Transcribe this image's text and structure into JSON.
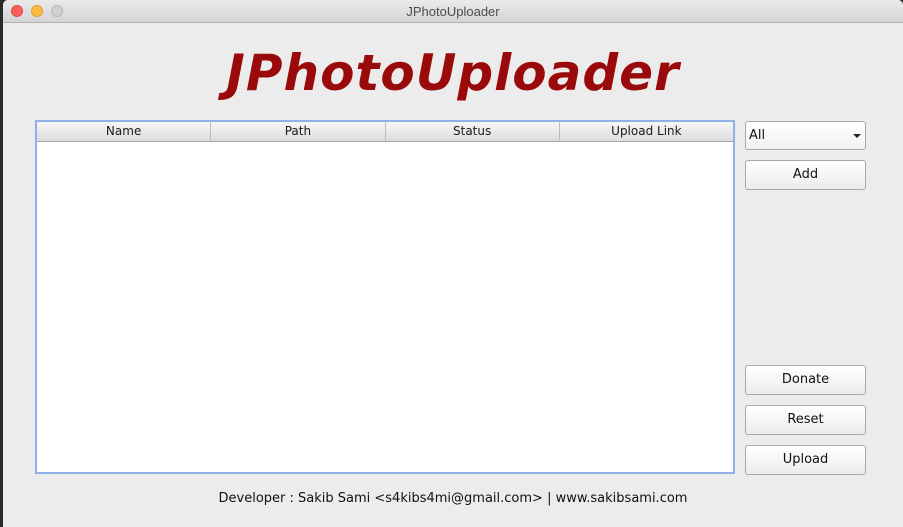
{
  "window": {
    "title": "JPhotoUploader"
  },
  "app": {
    "heading": "JPhotoUploader",
    "heading_color": "#9b0a0a"
  },
  "table": {
    "columns": [
      "Name",
      "Path",
      "Status",
      "Upload Link"
    ],
    "rows": []
  },
  "filter": {
    "selected": "All"
  },
  "buttons": {
    "add": "Add",
    "donate": "Donate",
    "reset": "Reset",
    "upload": "Upload"
  },
  "footer": {
    "text": "Developer : Sakib Sami <s4kibs4mi@gmail.com> | www.sakibsami.com"
  }
}
